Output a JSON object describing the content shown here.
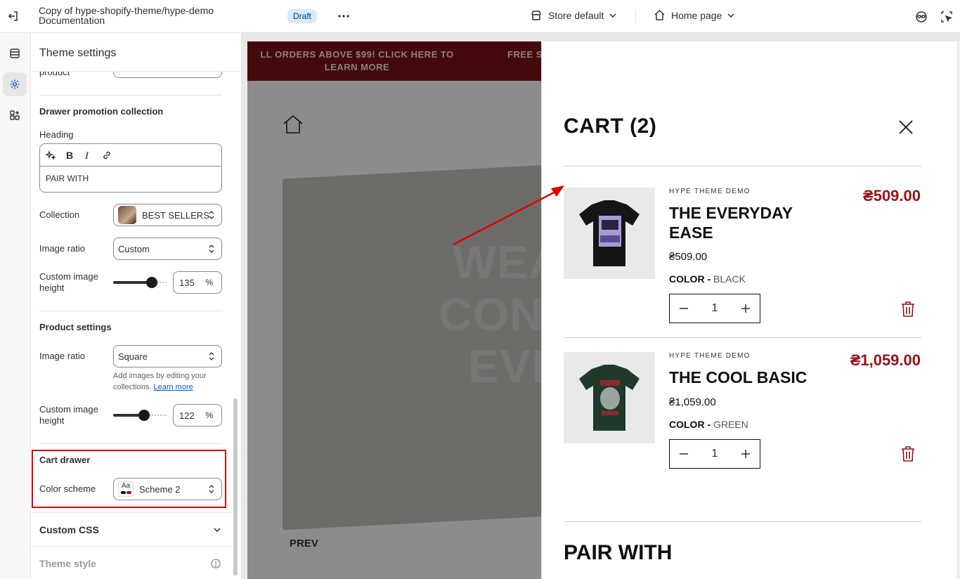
{
  "topbar": {
    "title_line1": "Copy of hype-shopify-theme/hype-demo",
    "title_line2": "Documentation",
    "status_badge": "Draft",
    "store_selector": "Store default",
    "page_selector": "Home page"
  },
  "panel": {
    "title": "Theme settings",
    "cut_label": "product",
    "drawer_promo": {
      "title": "Drawer promotion collection",
      "heading_label": "Heading",
      "heading_value": "PAIR WITH",
      "collection_label": "Collection",
      "collection_value": "BEST SELLERS",
      "image_ratio_label": "Image ratio",
      "image_ratio_value": "Custom",
      "custom_height_label": "Custom image height",
      "custom_height_value": "135",
      "custom_height_fraction": 0.72,
      "unit": "%"
    },
    "product_settings": {
      "title": "Product settings",
      "image_ratio_label": "Image ratio",
      "image_ratio_value": "Square",
      "hint": "Add images by editing your collections.",
      "hint_link": "Learn more",
      "custom_height_label": "Custom image height",
      "custom_height_value": "122",
      "custom_height_fraction": 0.58,
      "unit": "%"
    },
    "cart_drawer": {
      "title": "Cart drawer",
      "color_scheme_label": "Color scheme",
      "color_scheme_value": "Scheme 2",
      "swatch_text": "Aa"
    },
    "custom_css": "Custom CSS",
    "theme_style": "Theme style"
  },
  "preview": {
    "announcement_1": "LL ORDERS ABOVE $99! CLICK HERE TO LEARN MORE",
    "announcement_2": "FREE S",
    "hero_line1": "WEA",
    "hero_line2": "CON",
    "hero_line3": "EVI",
    "prev_label": "PREV"
  },
  "cart": {
    "title": "CART (2)",
    "items": [
      {
        "vendor": "HYPE THEME DEMO",
        "name": "THE EVERYDAY EASE",
        "price_big": "₴509.00",
        "price": "₴509.00",
        "variant_label": "COLOR -",
        "variant_value": "BLACK",
        "qty": "1"
      },
      {
        "vendor": "HYPE THEME DEMO",
        "name": "THE COOL BASIC",
        "price_big": "₴1,059.00",
        "price": "₴1,059.00",
        "variant_label": "COLOR -",
        "variant_value": "GREEN",
        "qty": "1"
      }
    ],
    "pair_with": "PAIR WITH"
  },
  "colors": {
    "accent_red": "#9a1118",
    "announcement_bg": "#7d1219",
    "highlight": "#e00000",
    "badge_bg": "#d5ebff"
  }
}
